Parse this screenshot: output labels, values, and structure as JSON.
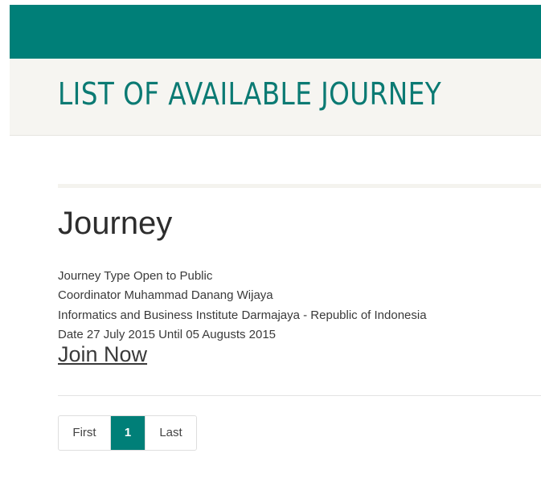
{
  "header": {
    "accent_color": "#007f78",
    "title": "LIST OF AVAILABLE JOURNEY"
  },
  "journey": {
    "heading": "Journey",
    "type_line": "Journey Type Open to Public",
    "coordinator_line": "Coordinator Muhammad Danang Wijaya",
    "institution_line": "Informatics and Business Institute Darmajaya - Republic of Indonesia",
    "date_line": "Date 27 July 2015 Until 05 Augusts 2015",
    "join_label": "Join Now"
  },
  "pagination": {
    "first_label": "First",
    "current_page": "1",
    "last_label": "Last"
  }
}
